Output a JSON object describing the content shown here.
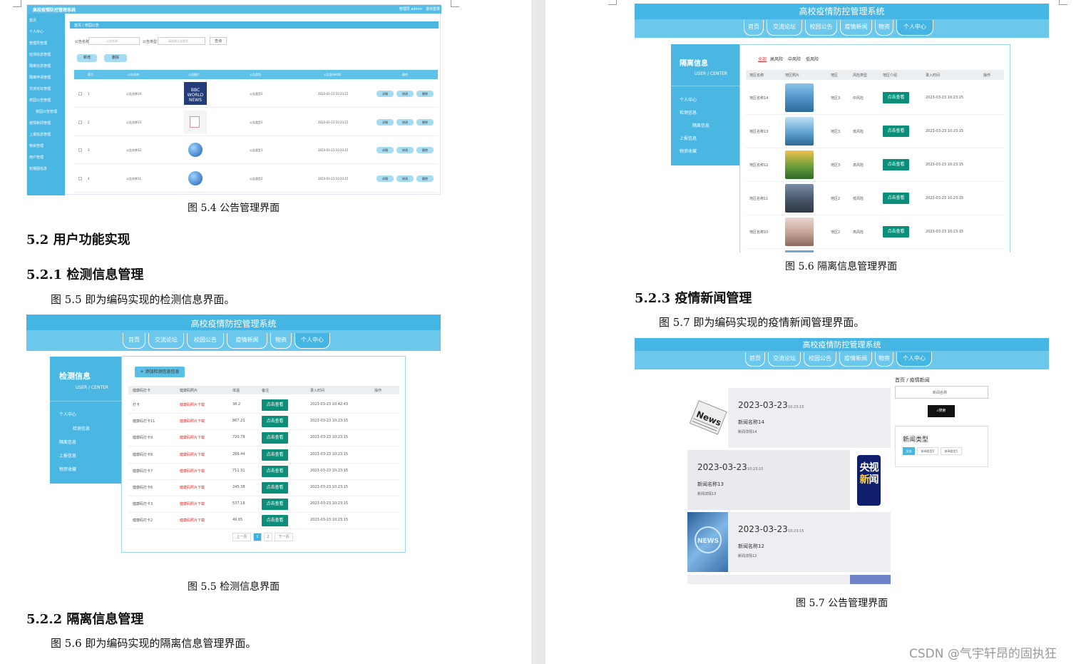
{
  "page1": {
    "fig54": {
      "header_title": "高校疫情防控管理系统",
      "header_right": "管理员 admin　退出登录",
      "sidebar": [
        "首页",
        "个人中心",
        "管理员管理",
        "检测信息管理",
        "隔离信息管理",
        "隔离申请管理",
        "交流论坛管理",
        "校园公告管理",
        "校园公告管理",
        "疫情新闻管理",
        "上报信息管理",
        "物资管理",
        "用户管理",
        "轮播图信息"
      ],
      "breadcrumb": "首页 / 校园公告",
      "search_labels": [
        "公告名称",
        "公告类型"
      ],
      "search_placeholders": [
        "公告名称",
        "请选择公告类型"
      ],
      "search_btn": "查询",
      "add_btn": "新增",
      "del_btn": "删除",
      "columns": [
        "索引",
        "公告名称",
        "公告图片",
        "公告类型",
        "公告发布时间",
        "操作"
      ],
      "rows": [
        {
          "idx": "1",
          "name": "公告名称14",
          "type": "公告类型2",
          "time": "2023-03-23 10:23:15"
        },
        {
          "idx": "2",
          "name": "公告名称13",
          "type": "公告类型1",
          "time": "2023-03-23 10:23:15"
        },
        {
          "idx": "3",
          "name": "公告名称12",
          "type": "公告类型1",
          "time": "2023-03-23 10:23:15"
        },
        {
          "idx": "4",
          "name": "公告名称11",
          "type": "公告类型2",
          "time": "2023-03-23 10:23:15"
        }
      ],
      "row_actions": [
        "详情",
        "修改",
        "删除"
      ]
    },
    "caption54": "图 5.4  公告管理界面",
    "h_52": "5.2  用户功能实现",
    "h_521": "5.2.1  检测信息管理",
    "p_55": "图 5.5  即为编码实现的检测信息界面。",
    "fig55": {
      "title": "高校疫情防控管理系统",
      "nav": [
        "首页",
        "交流论坛",
        "校园公告",
        "疫情新闻",
        "物资",
        "个人中心"
      ],
      "side_title": "检测信息",
      "side_sub": "USER / CENTER",
      "side_items": [
        "个人中心",
        "检测信息",
        "隔离信息",
        "上报信息",
        "物资收藏"
      ],
      "add_btn": "+ 添加检测信息信息",
      "columns": [
        "健康码打卡",
        "健康码照片",
        "体温",
        "备注",
        "录入时间",
        "操作"
      ],
      "rows": [
        {
          "a": "打卡",
          "b": "健康码照片下载",
          "c": "38.2",
          "d": "点击查看",
          "e": "2023-03-23 10:42:43"
        },
        {
          "a": "健康码打卡11",
          "b": "健康码照片下载",
          "c": "867.21",
          "d": "点击查看",
          "e": "2023-03-23 10:23:15"
        },
        {
          "a": "健康码打卡9",
          "b": "健康码照片下载",
          "c": "720.78",
          "d": "点击查看",
          "e": "2023-03-23 10:23:15"
        },
        {
          "a": "健康码打卡8",
          "b": "健康码照片下载",
          "c": "266.44",
          "d": "点击查看",
          "e": "2023-03-23 10:23:15"
        },
        {
          "a": "健康码打卡7",
          "b": "健康码照片下载",
          "c": "711.31",
          "d": "点击查看",
          "e": "2023-03-23 10:23:15"
        },
        {
          "a": "健康码打卡6",
          "b": "健康码照片下载",
          "c": "245.38",
          "d": "点击查看",
          "e": "2023-03-23 10:23:15"
        },
        {
          "a": "健康码打卡3",
          "b": "健康码照片下载",
          "c": "537.18",
          "d": "点击查看",
          "e": "2023-03-23 10:23:15"
        },
        {
          "a": "健康码打卡2",
          "b": "健康码照片下载",
          "c": "49.65",
          "d": "点击查看",
          "e": "2023-03-23 10:23:15"
        }
      ],
      "pager": [
        "上一页",
        "1",
        "2",
        "下一页"
      ]
    },
    "caption55": "图 5.5  检测信息界面",
    "h_522": "5.2.2  隔离信息管理",
    "p_56": "图 5.6  即为编码实现的隔离信息管理界面。"
  },
  "page2": {
    "fig56": {
      "title": "高校疫情防控管理系统",
      "nav": [
        "首页",
        "交流论坛",
        "校园公告",
        "疫情新闻",
        "物资",
        "个人中心"
      ],
      "side_title": "隔离信息",
      "side_sub": "USER / CENTER",
      "side_items": [
        "个人中心",
        "检测信息",
        "隔离信息",
        "上报信息",
        "物资收藏"
      ],
      "tabs": [
        "全部",
        "高风险",
        "中风险",
        "低风险"
      ],
      "columns": [
        "地区名称",
        "地区照片",
        "地区",
        "风险类型",
        "地区介绍",
        "录入时间",
        "操作"
      ],
      "rows": [
        {
          "name": "地区名称14",
          "area": "地区3",
          "risk": "中风险",
          "btn": "点击查看",
          "time": "2023-03-23 10:23:15"
        },
        {
          "name": "地区名称13",
          "area": "地区3",
          "risk": "低风险",
          "btn": "点击查看",
          "time": "2023-03-23 10:23:15"
        },
        {
          "name": "地区名称12",
          "area": "地区3",
          "risk": "高风险",
          "btn": "点击查看",
          "time": "2023-03-23 10:23:15"
        },
        {
          "name": "地区名称11",
          "area": "地区2",
          "risk": "低风险",
          "btn": "点击查看",
          "time": "2023-03-23 10:23:15"
        },
        {
          "name": "地区名称10",
          "area": "地区2",
          "risk": "高风险",
          "btn": "点击查看",
          "time": "2023-03-23 10:23:15"
        }
      ]
    },
    "caption56": "图 5.6  隔离信息管理界面",
    "h_523": "5.2.3  疫情新闻管理",
    "p_57": "图 5.7  即为编码实现的疫情新闻管理界面。",
    "fig57": {
      "title": "高校疫情防控管理系统",
      "nav": [
        "首页",
        "交流论坛",
        "校园公告",
        "疫情新闻",
        "物资",
        "个人中心"
      ],
      "breadcrumb": "首页 / 疫情新闻",
      "search_placeholder": "新闻名称",
      "search_btn": "搜索",
      "news": [
        {
          "date": "2023-03-23",
          "time": "10:23:15",
          "name": "新闻名称14",
          "detail": "新闻详情14"
        },
        {
          "date": "2023-03-23",
          "time": "10:23:15",
          "name": "新闻名称13",
          "detail": "新闻详情13"
        },
        {
          "date": "2023-03-23",
          "time": "10:23:15",
          "name": "新闻名称12",
          "detail": "新闻详情12"
        }
      ],
      "type_title": "新闻类型",
      "types": [
        "全部",
        "新闻类型2",
        "新闻类型1"
      ],
      "cctv": "央视新闻"
    },
    "caption57": "图 5.7  公告管理界面",
    "watermark": "CSDN @气宇轩昂的固执狂"
  }
}
